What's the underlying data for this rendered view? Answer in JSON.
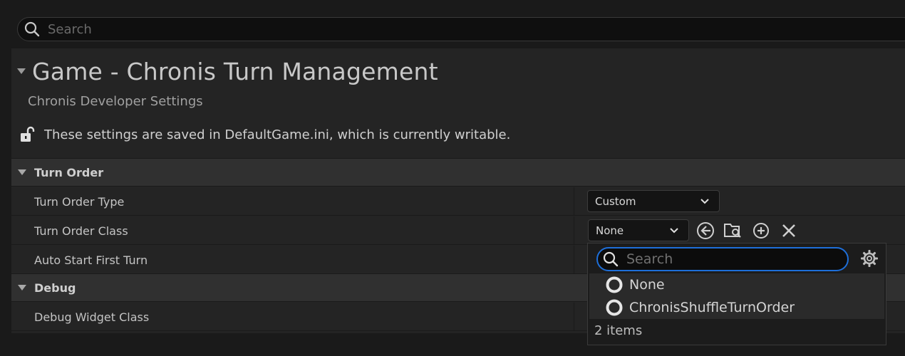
{
  "top_search": {
    "placeholder": "Search"
  },
  "section": {
    "title": "Game - Chronis Turn Management",
    "subtitle": "Chronis Developer Settings",
    "writable_message": "These settings are saved in DefaultGame.ini, which is currently writable."
  },
  "categories": [
    {
      "label": "Turn Order",
      "properties": [
        {
          "name": "Turn Order Type",
          "value": "Custom"
        },
        {
          "name": "Turn Order Class",
          "value": "None"
        },
        {
          "name": "Auto Start First Turn"
        }
      ]
    },
    {
      "label": "Debug",
      "properties": [
        {
          "name": "Debug Widget Class"
        }
      ]
    }
  ],
  "class_picker": {
    "search_placeholder": "Search",
    "items": [
      "None",
      "ChronisShuffleTurnOrder"
    ],
    "count_label": "2 items"
  },
  "icons": {
    "search": "search-icon",
    "expand": "triangle-down-icon",
    "lock": "unlocked-lock-icon",
    "chevron": "chevron-down-icon",
    "use_selected": "arrow-left-circle-icon",
    "browse": "folder-search-icon",
    "add": "plus-circle-icon",
    "clear": "close-icon",
    "settings": "gear-icon",
    "class_item": "ring-icon"
  },
  "colors": {
    "accent": "#1e6fd9",
    "background": "#1a1a1a",
    "panel": "#242424",
    "category": "#303030"
  }
}
